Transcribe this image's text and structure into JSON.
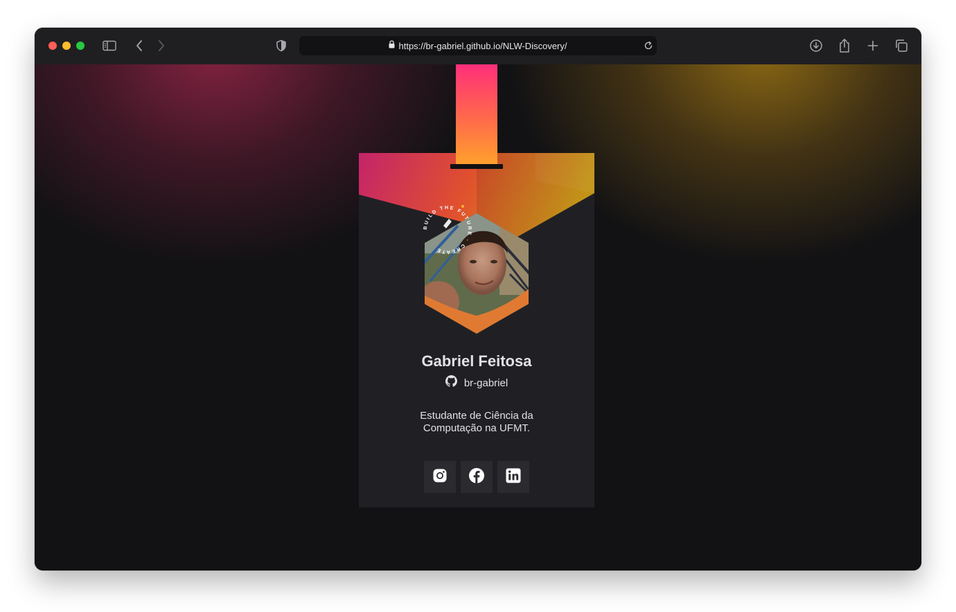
{
  "browser": {
    "url": "https://br-gabriel.github.io/NLW-Discovery/",
    "traffic_colors": {
      "close": "#ff5f57",
      "minimize": "#febc2e",
      "zoom": "#28c840"
    },
    "icons": [
      "sidebar-icon",
      "back-icon",
      "forward-icon",
      "shield-icon",
      "lock-icon",
      "reload-icon",
      "download-icon",
      "share-icon",
      "new-tab-icon",
      "tabs-overview-icon"
    ]
  },
  "card": {
    "badge_text": "BUILD THE FUTURE · CREATE",
    "name": "Gabriel Feitosa",
    "github_username": "br-gabriel",
    "bio": "Estudante de Ciência da Computação na UFMT.",
    "social_icons": [
      "instagram-icon",
      "facebook-icon",
      "linkedin-icon"
    ]
  },
  "colors": {
    "page_bg": "#121214",
    "card_bg": "#202024",
    "strap_top": "#ff2f7a",
    "strap_bottom": "#ffa22c",
    "text": "#e1e1e6"
  }
}
